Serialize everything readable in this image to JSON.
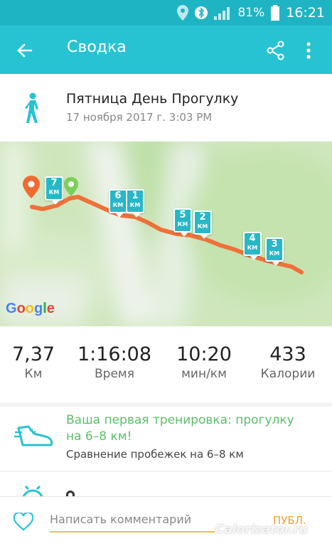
{
  "status_bar": {
    "battery_percent": "81%",
    "time": "16:21",
    "icons": [
      "location-icon",
      "bluetooth-icon",
      "signal-icon",
      "battery-icon"
    ]
  },
  "app_bar": {
    "title": "Сводка",
    "icons": [
      "back-arrow-icon",
      "share-icon",
      "more-vert-icon"
    ]
  },
  "activity": {
    "name": "Пятница День Прогулку",
    "date": "17 ноября 2017 г. 3:03 PM",
    "icon": "walking-person-icon"
  },
  "map": {
    "logo": "Google",
    "km_markers": [
      {
        "num": "7",
        "unit": "КМ"
      },
      {
        "num": "6",
        "unit": "КМ"
      },
      {
        "num": "1",
        "unit": "КМ"
      },
      {
        "num": "5",
        "unit": "КМ"
      },
      {
        "num": "2",
        "unit": "КМ"
      },
      {
        "num": "4",
        "unit": "КМ"
      },
      {
        "num": "3",
        "unit": "КМ"
      }
    ],
    "route_color": "#f0703a",
    "marker_color": "#26b8c8"
  },
  "stats": [
    {
      "value": "7,37",
      "label": "Км"
    },
    {
      "value": "1:16:08",
      "label": "Время"
    },
    {
      "value": "10:20",
      "label": "мин/км"
    },
    {
      "value": "433",
      "label": "Калории"
    }
  ],
  "achievement": {
    "title_line1": "Ваша первая тренировка: прогулку",
    "title_line2": "на 6–8 км!",
    "subtitle": "Сравнение пробежек на 6–8 км",
    "icon": "running-shoe-icon"
  },
  "comment": {
    "placeholder": "Написать комментарий",
    "publish_label": "ПУБЛ.",
    "icon": "heart-icon"
  },
  "watermark": "Calorizator.ru",
  "colors": {
    "primary": "#27c3d2",
    "status": "#1fb4c4",
    "accent": "#f0a030",
    "achievement": "#5bbf6a"
  }
}
